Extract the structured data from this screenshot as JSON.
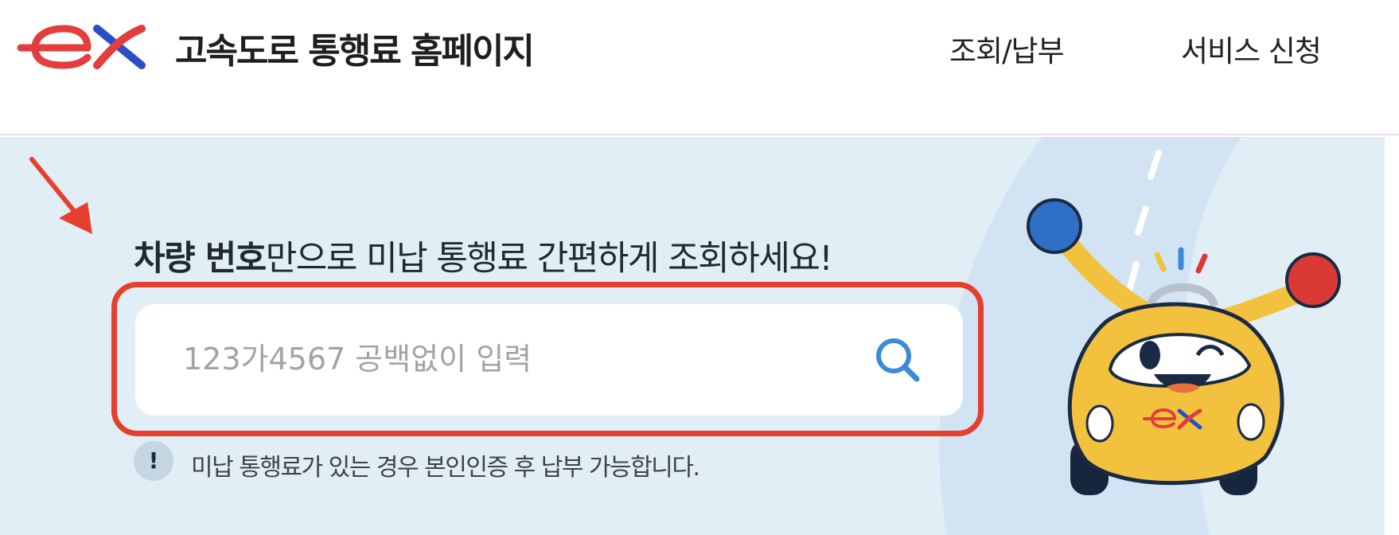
{
  "header": {
    "logo_text": "ex",
    "site_title": "고속도로 통행료 홈페이지",
    "nav": [
      {
        "label": "조회/납부"
      },
      {
        "label": "서비스 신청"
      }
    ]
  },
  "hero": {
    "headline_bold": "차량 번호",
    "headline_rest": "만으로 미납 통행료 간편하게 조회하세요!",
    "search": {
      "value": "",
      "placeholder": "123가4567 공백없이 입력",
      "icon": "search-icon"
    },
    "notice": {
      "icon": "!",
      "text": "미납 통행료가 있는 경우 본인인증 후 납부 가능합니다."
    },
    "mascot_logo_text": "ex"
  },
  "colors": {
    "brand_red": "#e33d3d",
    "brand_blue": "#2a4fc4",
    "annotation_red": "#e5402d",
    "hero_bg": "#e1eef6",
    "search_icon": "#3a8ad8"
  }
}
